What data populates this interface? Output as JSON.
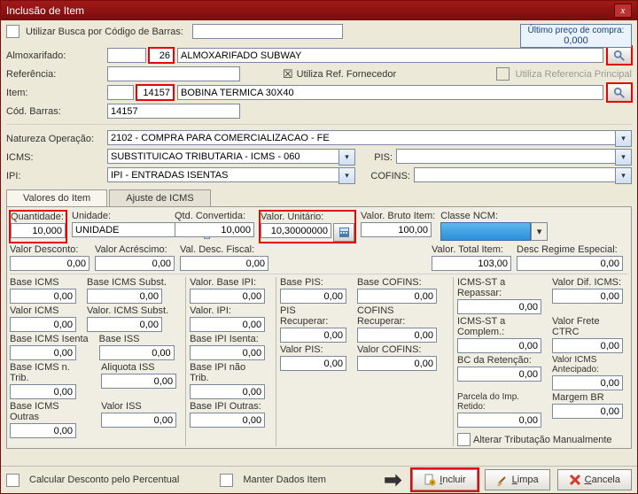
{
  "window": {
    "title": "Inclusão de Item",
    "close": "x"
  },
  "top": {
    "use_barcode": "Utilizar Busca por Código de Barras:",
    "last_price_lbl": "Último preço de compra:",
    "last_price_val": "0,000"
  },
  "head": {
    "almox_lbl": "Almoxarifado:",
    "almox_code": "26",
    "almox_name": "ALMOXARIFADO SUBWAY",
    "ref_lbl": "Referência:",
    "util_ref_forn": "Utiliza Ref. Fornecedor",
    "util_ref_forn_chk": "☒",
    "util_ref_princ": "Utiliza Referencia Principal",
    "item_lbl": "Item:",
    "item_code": "14157",
    "item_name": "BOBINA TERMICA 30X40",
    "codbar_lbl": "Cód. Barras:",
    "codbar_val": "14157"
  },
  "op": {
    "natop_lbl": "Natureza Operação:",
    "natop_val": "2102 - COMPRA PARA COMERCIALIZACAO - FE",
    "icms_lbl": "ICMS:",
    "icms_val": "SUBSTITUICAO TRIBUTARIA - ICMS - 060",
    "pis_lbl": "PIS:",
    "ipi_lbl": "IPI:",
    "ipi_val": "IPI - ENTRADAS ISENTAS",
    "cofins_lbl": "COFINS:"
  },
  "tabs": {
    "valores": "Valores do Item",
    "ajuste": "Ajuste de ICMS"
  },
  "vals": {
    "qtd_lbl": "Quantidade:",
    "qtd": "10,000",
    "unid_lbl": "Unidade:",
    "unid": "UNIDADE",
    "qtdconv_lbl": "Qtd. Convertida:",
    "qtdconv": "10,000",
    "vunit_lbl": "Valor. Unitário:",
    "vunit": "10,30000000",
    "vbruto_lbl": "Valor. Bruto Item:",
    "vbruto": "100,00",
    "ncm_lbl": "Classe NCM:",
    "vdesc_lbl": "Valor Desconto:",
    "vdesc": "0,00",
    "vacres_lbl": "Valor Acréscimo:",
    "vacres": "0,00",
    "vdf_lbl": "Val. Desc. Fiscal:",
    "vdf": "0,00",
    "vtot_lbl": "Valor. Total Item:",
    "vtot": "103,00",
    "dregesp_lbl": "Desc Regime Especial:",
    "dregesp": "0,00"
  },
  "tax": {
    "base_icms": "Base ICMS",
    "base_icms_subst": "Base ICMS Subst.",
    "valor_base_ipi": "Valor. Base IPI:",
    "base_pis": "Base PIS:",
    "base_cofins": "Base COFINS:",
    "icms_st_repassar": "ICMS-ST a Repassar:",
    "valor_dif_icms": "Valor Dif. ICMS:",
    "valor_icms": "Valor ICMS",
    "valor_icms_subst": "Valor. ICMS Subst.",
    "valor_ipi": "Valor. IPI:",
    "pis_recuperar": "PIS Recuperar:",
    "cofins_recuperar": "COFINS Recuperar:",
    "icms_st_complem": "ICMS-ST a Complem.:",
    "valor_frete_ctrc": "Valor Frete CTRC",
    "base_icms_isenta": "Base ICMS Isenta",
    "base_iss": "Base ISS",
    "base_ipi_isenta": "Base IPI Isenta:",
    "valor_pis": "Valor PIS:",
    "valor_cofins": "Valor COFINS:",
    "bc_retencao": "BC da Retenção:",
    "valor_icms_antecip": "Valor ICMS Antecipado:",
    "base_icms_ntrib": "Base ICMS n. Trib.",
    "aliq_iss": "Aliquota ISS",
    "base_ipi_ntrib": "Base IPI não Trib.",
    "parcela_imp_ret": "Parcela do Imp. Retido:",
    "margem_br": "Margem BR",
    "base_icms_outras": "Base ICMS Outras",
    "valor_iss": "Valor ISS",
    "base_ipi_outras": "Base IPI Outras:",
    "alterar_trib": "Alterar Tributação Manualmente",
    "zero": "0,00"
  },
  "footer": {
    "calc_desc_perc": "Calcular Desconto pelo Percentual",
    "manter_dados": "Manter Dados Item",
    "incluir": "Incluir",
    "limpa": "Limpa",
    "cancela": "Cancela"
  }
}
